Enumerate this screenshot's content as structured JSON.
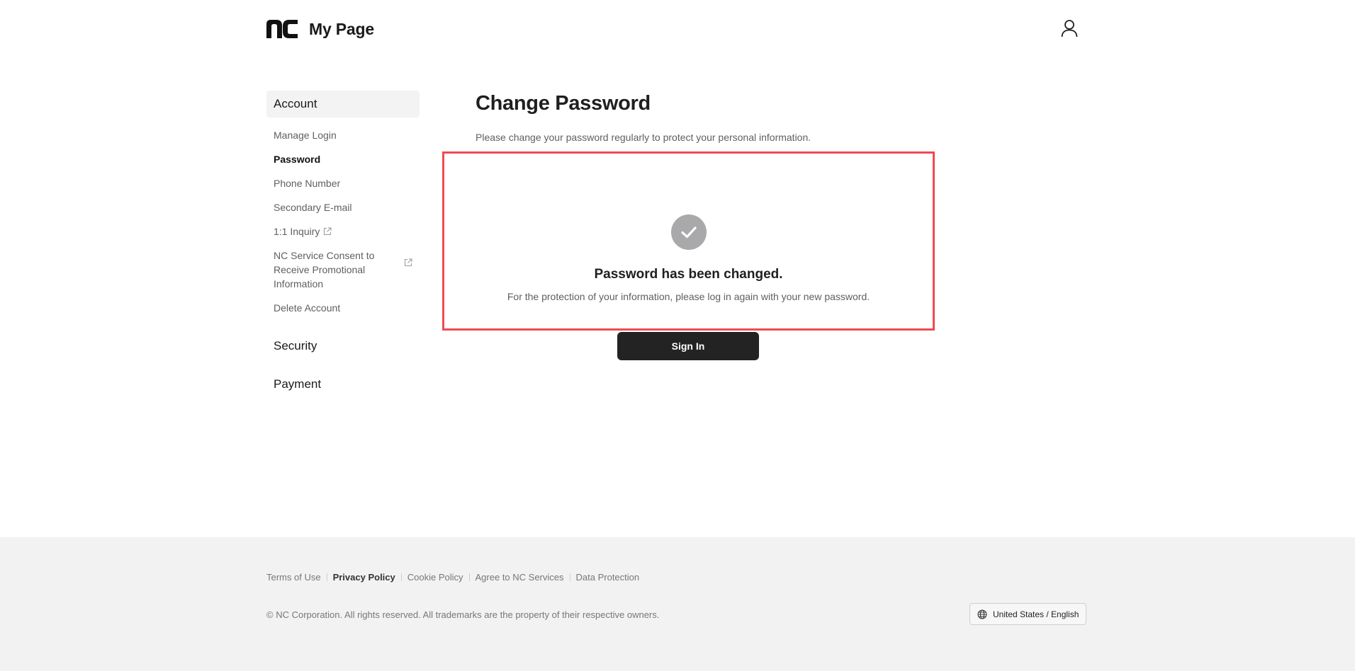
{
  "header": {
    "logo_text": "nc",
    "title": "My Page",
    "user_icon": "user-icon"
  },
  "sidebar": {
    "account": {
      "label": "Account",
      "items": [
        {
          "label": "Manage Login",
          "selected": false,
          "external": false
        },
        {
          "label": "Password",
          "selected": true,
          "external": false
        },
        {
          "label": "Phone Number",
          "selected": false,
          "external": false
        },
        {
          "label": "Secondary E-mail",
          "selected": false,
          "external": false
        },
        {
          "label": "1:1 Inquiry",
          "selected": false,
          "external": true
        },
        {
          "label": "NC Service Consent to Receive Promotional Information",
          "selected": false,
          "external": true
        },
        {
          "label": "Delete Account",
          "selected": false,
          "external": false
        }
      ]
    },
    "security": {
      "label": "Security"
    },
    "payment": {
      "label": "Payment"
    }
  },
  "main": {
    "title": "Change Password",
    "description": "Please change your password regularly to protect your personal information.",
    "result": {
      "icon": "check-circle-icon",
      "title": "Password has been changed.",
      "message": "For the protection of your information, please log in again with your new password."
    },
    "signin_label": "Sign In"
  },
  "footer": {
    "links": [
      {
        "label": "Terms of Use",
        "bold": false
      },
      {
        "label": "Privacy Policy",
        "bold": true
      },
      {
        "label": "Cookie Policy",
        "bold": false
      },
      {
        "label": "Agree to NC Services",
        "bold": false
      },
      {
        "label": "Data Protection",
        "bold": false
      }
    ],
    "copyright": "© NC Corporation. All rights reserved. All trademarks are the property of their respective owners.",
    "language": "United States / English"
  },
  "colors": {
    "accent_box_border": "#ee4b52",
    "button_bg": "#232323",
    "check_circle": "#a9a9ab",
    "footer_bg": "#f2f2f2"
  }
}
